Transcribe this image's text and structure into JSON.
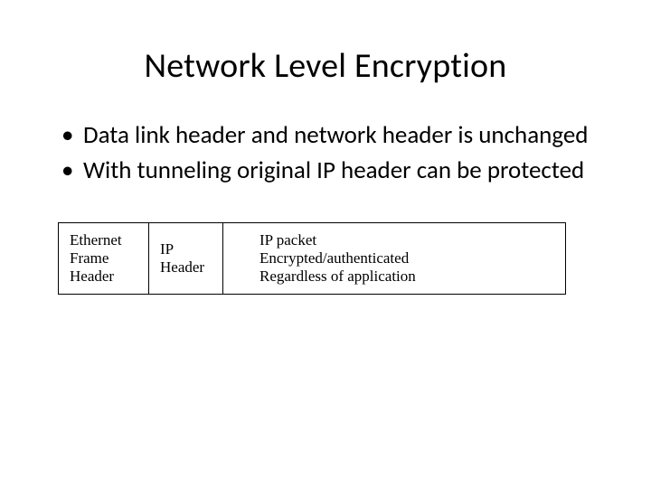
{
  "title": "Network Level Encryption",
  "bullets": [
    "Data link header and network header is unchanged",
    "With tunneling original IP header can be protected"
  ],
  "diagram": {
    "cell1": {
      "line1": "Ethernet",
      "line2": "Frame",
      "line3": "Header"
    },
    "cell2": {
      "line1": "IP",
      "line2": "Header"
    },
    "cell3": {
      "line1": "IP packet",
      "line2": "Encrypted/authenticated",
      "line3": "Regardless of application"
    }
  }
}
